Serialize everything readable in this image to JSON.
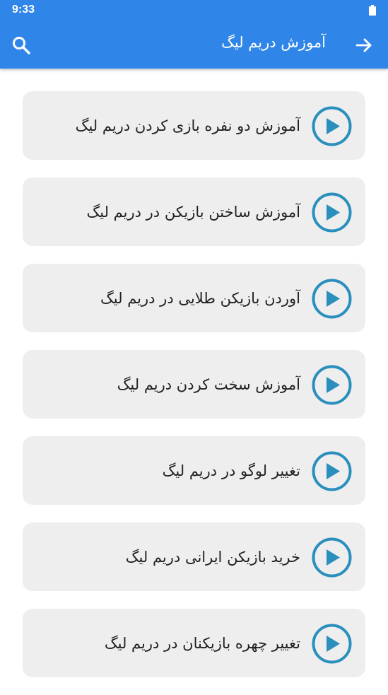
{
  "status_bar": {
    "time": "9:33"
  },
  "app_bar": {
    "title": "آموزش دریم لیگ"
  },
  "items": [
    {
      "label": "آموزش دو نفره بازی کردن دریم لیگ"
    },
    {
      "label": "آموزش ساختن بازیکن در دریم لیگ"
    },
    {
      "label": "آوردن بازیکن طلایی در دریم لیگ"
    },
    {
      "label": "آموزش سخت کردن دریم لیگ"
    },
    {
      "label": "تغییر لوگو در دریم لیگ"
    },
    {
      "label": "خرید بازیکن ایرانی دریم لیگ"
    },
    {
      "label": "تغییر چهره بازیکنان در دریم لیگ"
    }
  ],
  "colors": {
    "app_bar": "#2f86e8",
    "card": "#eeeeee",
    "play": "#2a8fbd"
  }
}
